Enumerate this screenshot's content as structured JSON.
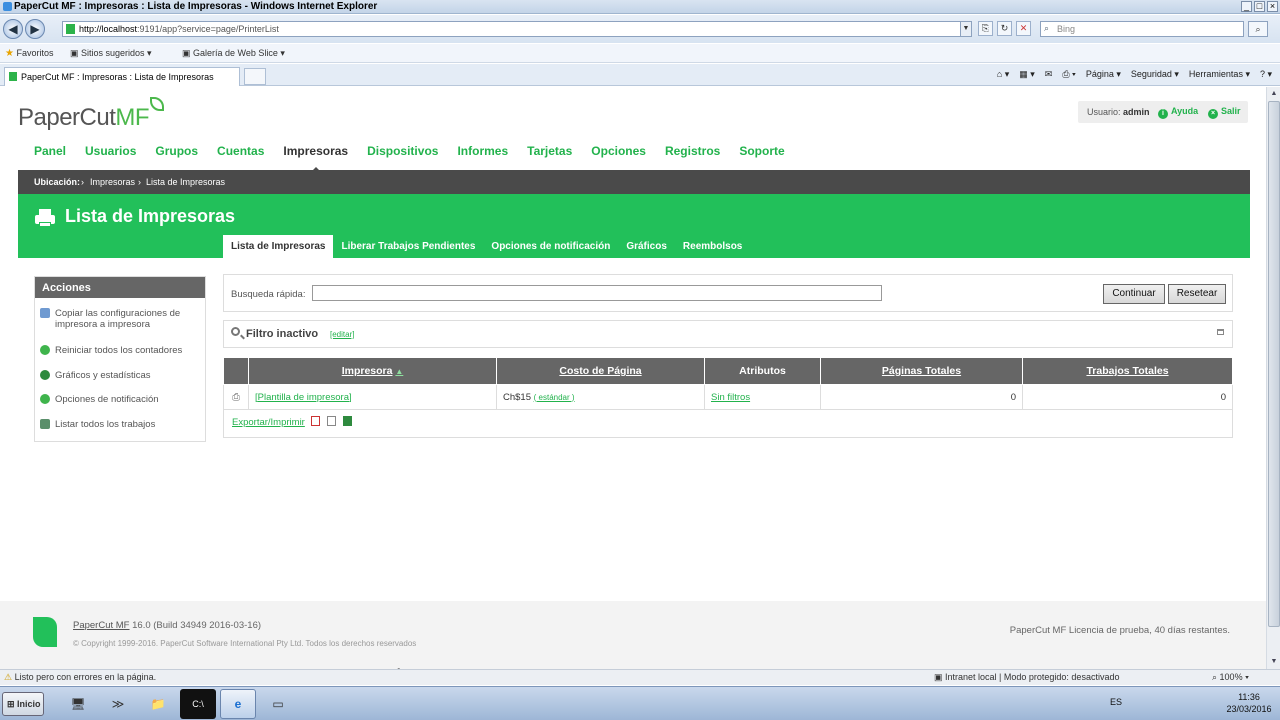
{
  "window": {
    "title": "PaperCut MF : Impresoras : Lista de Impresoras - Windows Internet Explorer"
  },
  "browser": {
    "url_host": "http://localhost",
    "url_rest": ":9191/app?service=page/PrinterList",
    "search_placeholder": "Bing",
    "favorites_label": "Favoritos",
    "fav_items": [
      "Sitios sugeridos ▾",
      "Galería de Web Slice ▾"
    ],
    "tab_label": "PaperCut MF : Impresoras : Lista de Impresoras",
    "cmd_items": [
      "Página ▾",
      "Seguridad ▾",
      "Herramientas ▾"
    ]
  },
  "header": {
    "logo_text": "PaperCut",
    "logo_suffix": "MF",
    "user_label": "Usuario:",
    "user_name": "admin",
    "help_label": "Ayuda",
    "exit_label": "Salir"
  },
  "nav": {
    "items": [
      "Panel",
      "Usuarios",
      "Grupos",
      "Cuentas",
      "Impresoras",
      "Dispositivos",
      "Informes",
      "Tarjetas",
      "Opciones",
      "Registros",
      "Soporte"
    ],
    "active": "Impresoras"
  },
  "breadcrumb": {
    "label": "Ubicación:",
    "items": [
      "Impresoras",
      "Lista de Impresoras"
    ]
  },
  "page": {
    "title": "Lista de Impresoras",
    "subtabs": [
      "Lista de Impresoras",
      "Liberar Trabajos Pendientes",
      "Opciones de notificación",
      "Gráficos",
      "Reembolsos"
    ]
  },
  "sidebar": {
    "title": "Acciones",
    "items": [
      {
        "label": "Copiar las configuraciones de impresora a impresora",
        "icon": "copy-icon",
        "color": "#6f9ad1"
      },
      {
        "label": "Reiniciar todos los contadores",
        "icon": "reset-icon",
        "color": "#3fb44c"
      },
      {
        "label": "Gráficos y estadísticas",
        "icon": "pie-chart-icon",
        "color": "#2e8a3e"
      },
      {
        "label": "Opciones de notificación",
        "icon": "notification-icon",
        "color": "#3fb44c"
      },
      {
        "label": "Listar todos los trabajos",
        "icon": "list-icon",
        "color": "#5a8f6a"
      }
    ]
  },
  "search": {
    "label": "Busqueda rápida:",
    "value": "",
    "continue_label": "Continuar",
    "reset_label": "Resetear"
  },
  "filter": {
    "title": "Filtro inactivo",
    "edit_label": "[editar]"
  },
  "table": {
    "columns": [
      "Impresora",
      "Costo de Página",
      "Atributos",
      "Páginas Totales",
      "Trabajos Totales"
    ],
    "rows": [
      {
        "printer": "[Plantilla de impresora]",
        "cost": "Ch$15",
        "cost_note": "( estándar )",
        "attrs": "Sin filtros",
        "pages": "0",
        "jobs": "0"
      }
    ],
    "export_label": "Exportar/Imprimir"
  },
  "footer": {
    "product": "PaperCut MF",
    "version": " 16.0 (Build 34949 2016-03-16)",
    "copyright": "© Copyright 1999-2016. PaperCut Software International Pty Ltd. Todos los derechos reservados",
    "license": "PaperCut MF Licencia de prueba, 40 días restantes."
  },
  "statusbar": {
    "status": "Listo pero con errores en la página.",
    "zone": "Intranet local | Modo protegido: desactivado",
    "zoom": "100%"
  },
  "taskbar": {
    "start_label": "Inicio",
    "lang": "ES",
    "time": "11:36",
    "date": "23/03/2016"
  },
  "colors": {
    "brand_green": "#22c05a",
    "link_green": "#22b24c",
    "dark_bar": "#4a4a4a"
  }
}
